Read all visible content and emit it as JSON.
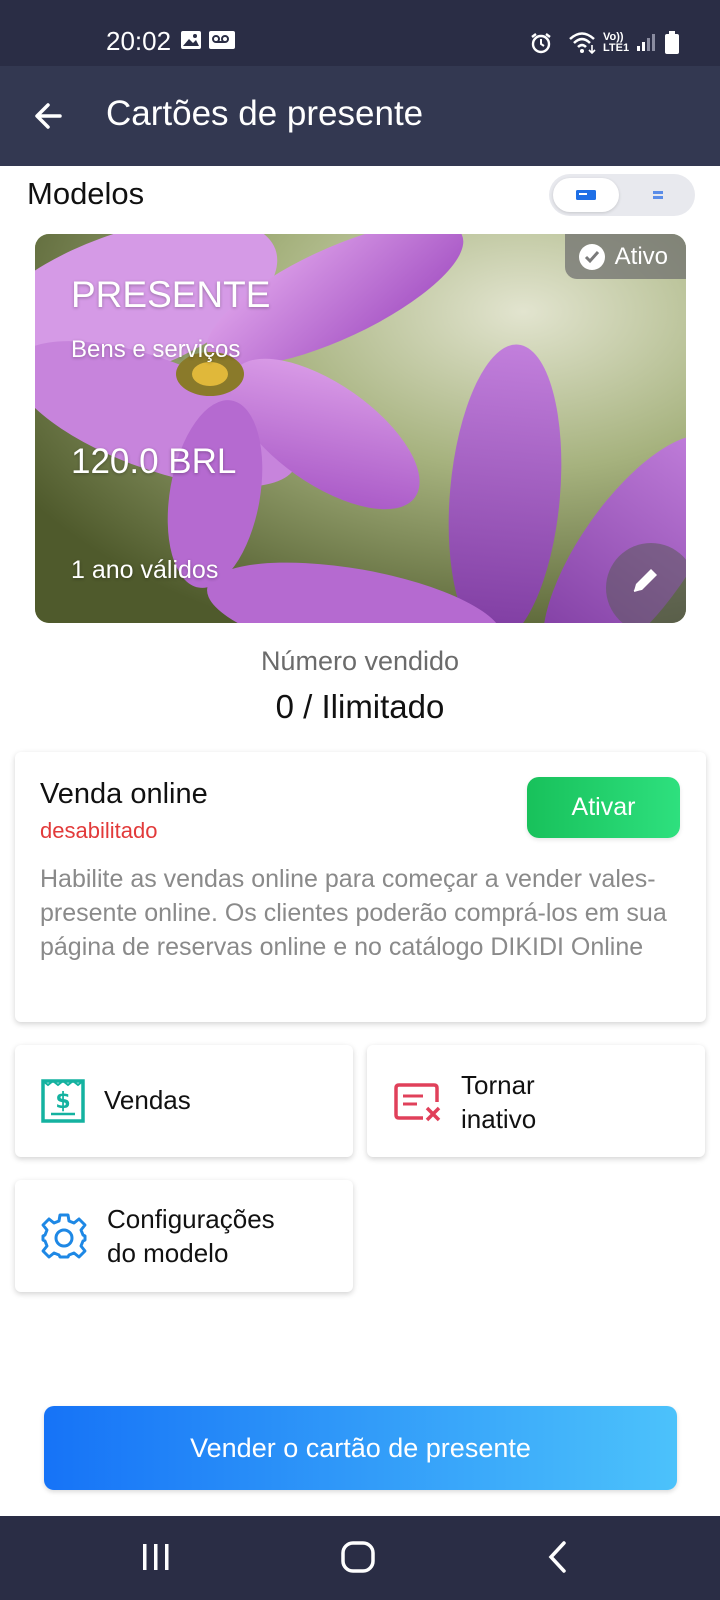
{
  "status_bar": {
    "time": "20:02",
    "network": "LTE1"
  },
  "app_bar": {
    "title": "Cartões de presente"
  },
  "section": {
    "title": "Modelos"
  },
  "gift_card": {
    "title": "PRESENTE",
    "subtitle": "Bens e serviços",
    "amount": "120.0 BRL",
    "validity": "1 ano válidos",
    "badge": "Ativo"
  },
  "sold": {
    "label": "Número vendido",
    "value": "0 / Ilimitado"
  },
  "online_sale": {
    "title": "Venda online",
    "status": "desabilitado",
    "button": "Ativar",
    "description": "Habilite as vendas online para começar a vender vales-presente online. Os clientes poderão comprá-los em sua página de reservas online e no catálogo DIKIDI Online"
  },
  "actions": {
    "sales": "Vendas",
    "deactivate_line1": "Tornar",
    "deactivate_line2": "inativo",
    "settings_line1": "Configurações",
    "settings_line2": "do modelo"
  },
  "cta": {
    "label": "Vender o cartão de presente"
  },
  "colors": {
    "header": "#333851",
    "status_bar": "#2a2d45",
    "activate_green": "#18c15b",
    "disabled_red": "#e23a3a",
    "cta_blue": "#1673f7",
    "sales_icon": "#14b2a0",
    "deactivate_icon": "#e0405a",
    "settings_icon": "#1e88e5"
  }
}
